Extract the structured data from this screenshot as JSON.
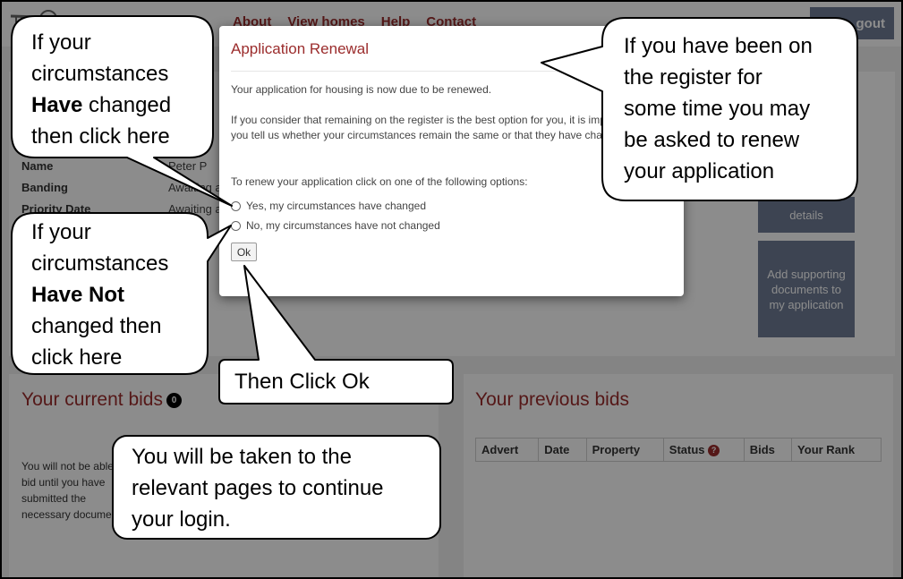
{
  "nav": {
    "links": [
      "About",
      "View homes",
      "Help",
      "Contact"
    ],
    "logout_label": "gout"
  },
  "profile": {
    "rows": [
      {
        "label": "Name",
        "value": "Peter P"
      },
      {
        "label": "Banding",
        "value": "Awaiting a"
      },
      {
        "label": "Priority Date",
        "value": "Awaiting a"
      }
    ]
  },
  "side_buttons": {
    "details_label": "details",
    "supporting_label": "Add supporting documents to my application"
  },
  "current_bids": {
    "title": "Your current bids",
    "count": "0",
    "note": "You will not be able to bid until you have submitted the necessary documents"
  },
  "previous_bids": {
    "title": "Your previous bids",
    "columns": [
      "Advert",
      "Date",
      "Property",
      "Status",
      "Bids",
      "Your Rank"
    ],
    "status_help_icon": "?"
  },
  "modal": {
    "title": "Application Renewal",
    "para1": "Your application for housing is now due to be renewed.",
    "para2": "If you consider that remaining on the register is the best option for you, it is important that you tell us whether your circumstances remain the same or that they have changed.",
    "para3": "To renew your application click on one of the following options:",
    "option_yes": "Yes, my circumstances have changed",
    "option_no": "No, my circumstances have not changed",
    "ok_label": "Ok"
  },
  "callouts": {
    "have_changed": {
      "line1": "If your",
      "line2": "circumstances",
      "bold": "Have",
      "rest": " changed",
      "line4": "then click here"
    },
    "have_not_changed": {
      "line1": "If your",
      "line2": "circumstances",
      "bold": "Have Not",
      "line4": "changed then",
      "line5": "click here"
    },
    "renew_info": {
      "line1": "If you have been on",
      "line2": "the register for",
      "line3": "some time you may",
      "line4": "be asked to renew",
      "line5": "your application"
    },
    "click_ok": {
      "text": "Then Click Ok"
    },
    "taken_to": {
      "line1": "You will be taken to the",
      "line2": "relevant pages to continue",
      "line3": "your login."
    }
  }
}
